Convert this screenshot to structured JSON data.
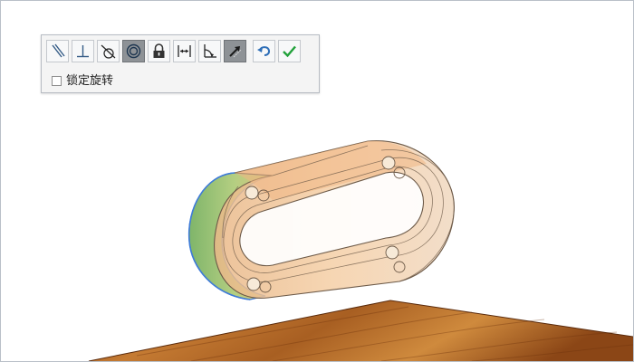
{
  "toolbar": {
    "lock_rotation_label": "锁定旋转",
    "lock_rotation_checked": false,
    "buttons": [
      {
        "icon": "parallel-icon",
        "active": false
      },
      {
        "icon": "perpendicular-icon",
        "active": false
      },
      {
        "icon": "tangent-icon",
        "active": false
      },
      {
        "icon": "concentric-icon",
        "active": true
      },
      {
        "icon": "lock-icon",
        "active": false
      },
      {
        "icon": "distance-icon",
        "active": false
      },
      {
        "icon": "angle-icon",
        "active": false
      },
      {
        "icon": "flip-direction-icon",
        "active": true
      },
      {
        "icon": "undo-icon",
        "active": false
      },
      {
        "icon": "confirm-check-icon",
        "active": false
      }
    ]
  },
  "colors": {
    "part_face": "#f4c89c",
    "part_edge": "#6d5a48",
    "part_green": "#9cc776",
    "wood_light": "#c77f35",
    "wood_dark": "#7b3e12",
    "selected_edge": "#3e7bd8",
    "confirm_green": "#21a13a",
    "undo_blue": "#2f6fb8"
  }
}
